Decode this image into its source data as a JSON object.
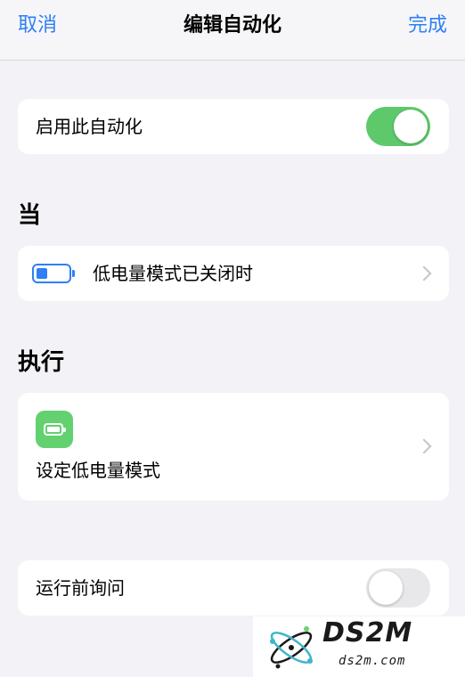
{
  "nav": {
    "cancel_label": "取消",
    "title": "编辑自动化",
    "done_label": "完成"
  },
  "enable_row": {
    "label": "启用此自动化",
    "toggle_on": true
  },
  "when_section": {
    "title": "当",
    "trigger_label": "低电量模式已关闭时"
  },
  "do_section": {
    "title": "执行",
    "action_label": "设定低电量模式"
  },
  "ask_row": {
    "label": "运行前询问",
    "toggle_on": false
  },
  "watermark": {
    "brand": "DS2M",
    "domain": "ds2m.com"
  },
  "colors": {
    "accent": "#2f7ff5",
    "toggle_on": "#5ec96a",
    "action_icon": "#63d170",
    "background": "#f2f2f7"
  }
}
